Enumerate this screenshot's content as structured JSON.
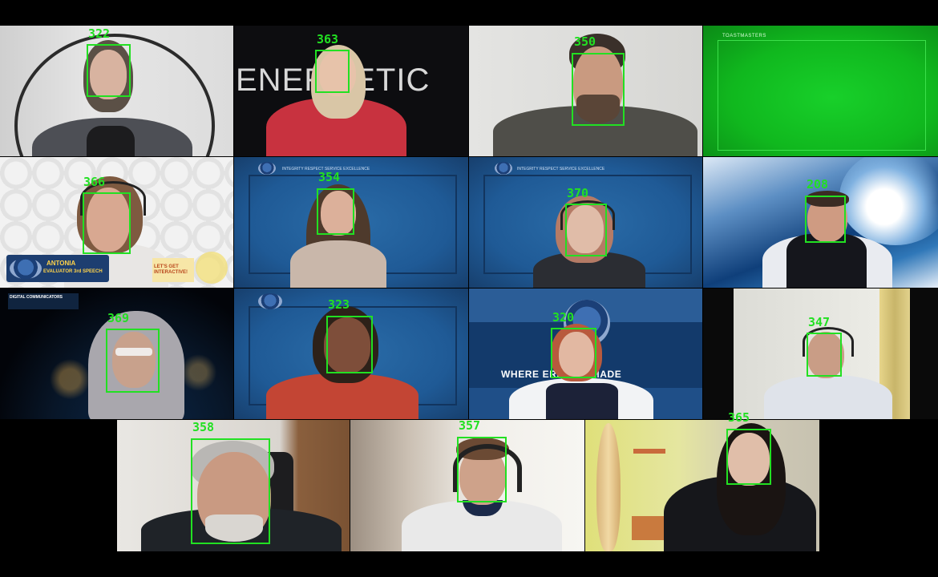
{
  "gallery": {
    "tiles": [
      {
        "id": "322"
      },
      {
        "id": "363",
        "backdrop_word": "ENERGETIC"
      },
      {
        "id": "350"
      },
      {
        "id": "",
        "banner": "TOASTMASTERS"
      },
      {
        "id": "366",
        "name_tag": "ANTONIA",
        "role_tag": "EVALUATOR 3rd SPEECH",
        "slogan": "LET'S GET INTERACTIVE!"
      },
      {
        "id": "354",
        "values_bar": "INTEGRITY    RESPECT    SERVICE    EXCELLENCE"
      },
      {
        "id": "370",
        "values_bar": "INTEGRITY    RESPECT    SERVICE    EXCELLENCE"
      },
      {
        "id": "208"
      },
      {
        "id": "369",
        "club_name": "DIGITAL COMMUNICATORS"
      },
      {
        "id": "323"
      },
      {
        "id": "320",
        "slogan": "WHERE LEADERS ARE MADE",
        "visible_slogan": "WHERE ERS ARE MADE"
      },
      {
        "id": "347"
      },
      {
        "id": "358"
      },
      {
        "id": "357"
      },
      {
        "id": "365"
      }
    ]
  },
  "colors": {
    "detection_box": "#22e022",
    "chroma_green": "#10b81e",
    "toastmasters_blue": "#1f5a96"
  }
}
